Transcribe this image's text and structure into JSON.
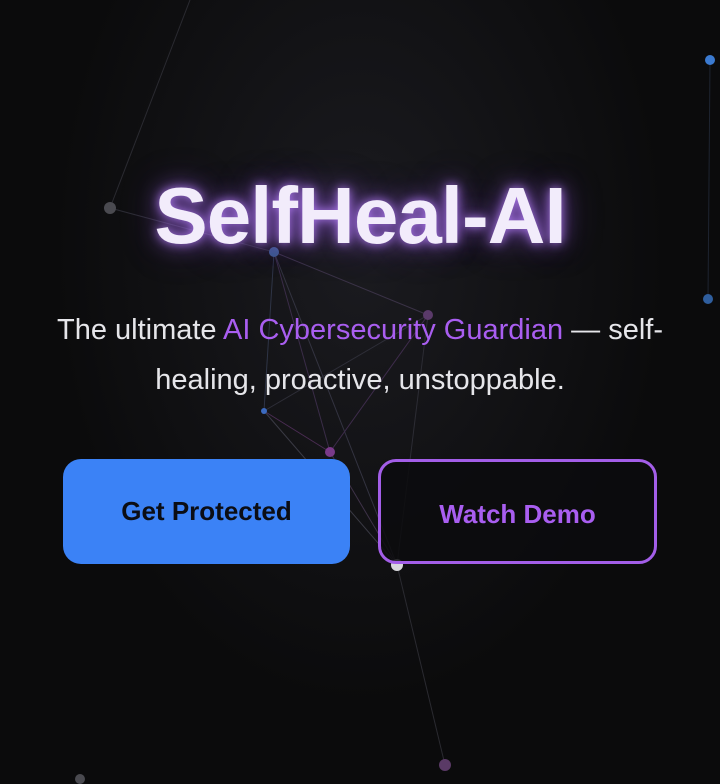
{
  "hero": {
    "title": "SelfHeal-AI",
    "subtitle_before": "The ultimate ",
    "subtitle_accent": "AI Cybersecurity Guardian",
    "subtitle_after": " — self-healing, proactive, unstoppable."
  },
  "buttons": {
    "primary_label": "Get Protected",
    "secondary_label": "Watch Demo"
  },
  "colors": {
    "background": "#0b0b0c",
    "accent_purple": "#a95ef0",
    "primary_blue": "#3b82f6",
    "title_glow": "#ba82ff"
  }
}
